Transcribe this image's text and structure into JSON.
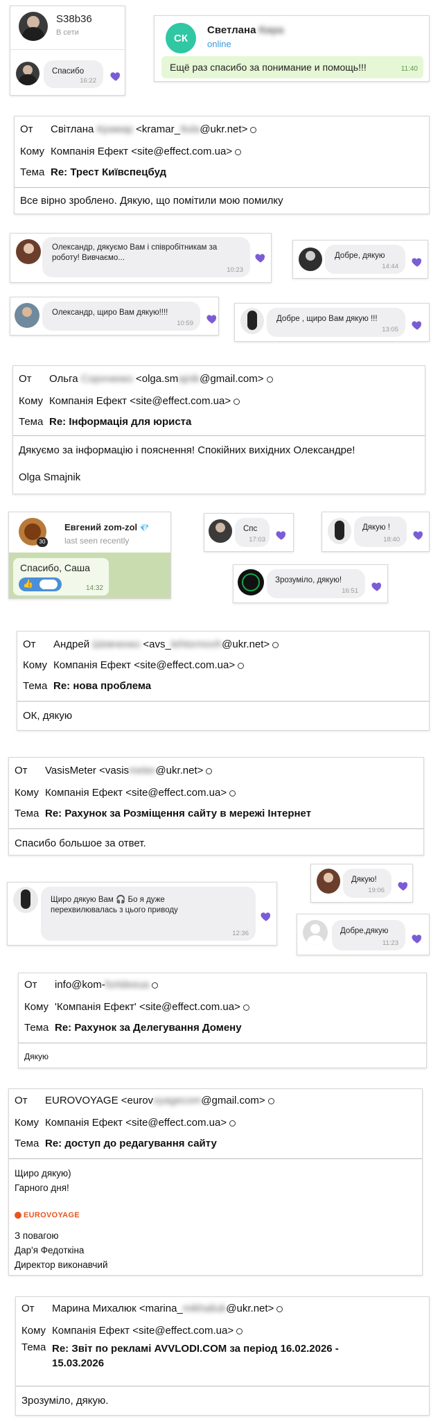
{
  "colors": {
    "heart": "#7b5cd6",
    "online": "#3a9ad9",
    "tg_bubble": "#e6f7d6",
    "sk_avatar": "#2fc7a4",
    "eurovoyage": "#e8541e"
  },
  "chat1": {
    "name": "S38b36",
    "status": "В сети",
    "message": "Спасибо",
    "time": "16:22"
  },
  "chat2": {
    "avatar_initials": "СК",
    "name": "Светлана",
    "name_blurred": "Кира",
    "status": "online",
    "message": "Ещё  раз спасибо за понимание и помощь!!!",
    "time": "11:40"
  },
  "email1": {
    "from_label": "От",
    "from_name": "Світлана",
    "from_name_blurred": "Крамар",
    "from_email_pre": "<kramar_",
    "from_email_blur": "9ula",
    "from_email_post": "@ukr.net>",
    "to_label": "Кому",
    "to": "Компанія Ефект <site@effect.com.ua>",
    "subject_label": "Тема",
    "subject": "Re: Трест Київспецбуд",
    "body": "Все вірно зроблено. Дякую, що помітили мою помилку"
  },
  "chat3": {
    "message": "Олександр, дякуємо Вам і співробітникам за роботу! Вивчаємо...",
    "time": "10:23"
  },
  "chat4": {
    "message": "Добре, дякую",
    "time": "14:44"
  },
  "chat5": {
    "message": "Олександр, щиро Вам дякую!!!!",
    "time": "10:59"
  },
  "chat6": {
    "message": "Добре , щиро Вам дякую !!!",
    "time": "13:05"
  },
  "email2": {
    "from_label": "От",
    "from_name": "Ольга",
    "from_name_blurred": "Сорочинко",
    "from_email_pre": "<olga.sm",
    "from_email_blur": "ajnik",
    "from_email_post": "@gmail.com>",
    "to_label": "Кому",
    "to": "Компанія Ефект <site@effect.com.ua>",
    "subject_label": "Тема",
    "subject": "Re: Інформація для юриста",
    "body": "Дякуємо за інформацію і пояснення! Спокійних вихідних Олександре!",
    "signature": "Olga Smajnik"
  },
  "chat7": {
    "name": "Евгений zom-zol",
    "badge": "💎",
    "status": "last seen recently",
    "message": "Спасибо, Саша",
    "reaction": "👍",
    "time": "14:32"
  },
  "chat8": {
    "message": "Спс",
    "time": "17:03"
  },
  "chat9": {
    "message": "Дякую !",
    "time": "18:40"
  },
  "chat10": {
    "message": "Зрозуміло, дякую!",
    "time": "16:51"
  },
  "email3": {
    "from_label": "От",
    "from_name": "Андрей",
    "from_name_blurred": "Шевченко",
    "from_email_pre": "<avs_",
    "from_email_blur": "lehtsrmovh",
    "from_email_post": "@ukr.net>",
    "to_label": "Кому",
    "to": "Компанія Ефект <site@effect.com.ua>",
    "subject_label": "Тема",
    "subject": "Re: нова проблема",
    "body": "ОК, дякую"
  },
  "email4": {
    "from_label": "От",
    "from_name": "VasisMeter",
    "from_email_pre": "<vasis",
    "from_email_blur": "meter",
    "from_email_post": "@ukr.net>",
    "to_label": "Кому",
    "to": "Компанія Ефект <site@effect.com.ua>",
    "subject_label": "Тема",
    "subject": "Re: Рахунок за Розміщення сайту в мережі Інтернет",
    "body": "Спасибо большое за ответ."
  },
  "chat11": {
    "message": "Щиро дякую Вам 🎧 Бо я дуже перехвилювалась з цього приводу",
    "time": "12:36"
  },
  "chat12": {
    "message": "Дякую!",
    "time": "19:06"
  },
  "chat13": {
    "message": "Добре,дякую",
    "time": "11:23"
  },
  "email5": {
    "from_label": "От",
    "from_name": "info@kom-",
    "from_name_blurred": "fortdeeua",
    "to_label": "Кому",
    "to": "'Компанія Ефект' <site@effect.com.ua>",
    "subject_label": "Тема",
    "subject": "Re: Рахунок за Делегування Домену",
    "body": "Дякую"
  },
  "email6": {
    "from_label": "От",
    "from_name": "EUROVOYAGE",
    "from_email_pre": "<eurov",
    "from_email_blur": "oyagecom",
    "from_email_post": "@gmail.com>",
    "to_label": "Кому",
    "to": "Компанія Ефект <site@effect.com.ua>",
    "subject_label": "Тема",
    "subject": "Re: доступ до редагування сайту",
    "body_lines": [
      "Щиро дякую)",
      "Гарного дня!"
    ],
    "logo_text": "EUROVOYAGE",
    "signature_lines": [
      "З повагою",
      "Дар'я Федоткіна",
      "Директор виконавчий"
    ]
  },
  "email7": {
    "from_label": "От",
    "from_name": "Марина Михалюк",
    "from_email_pre": "<marina_",
    "from_email_blur": "mikhaliuk",
    "from_email_post": "@ukr.net>",
    "to_label": "Кому",
    "to": "Компанія Ефект <site@effect.com.ua>",
    "subject_label": "Тема",
    "subject_line1": "Re: Звіт по рекламі AVVLODI.COM за період 16.02.2026 -",
    "subject_line2": "15.03.2026",
    "body": "Зрозуміло, дякую."
  }
}
